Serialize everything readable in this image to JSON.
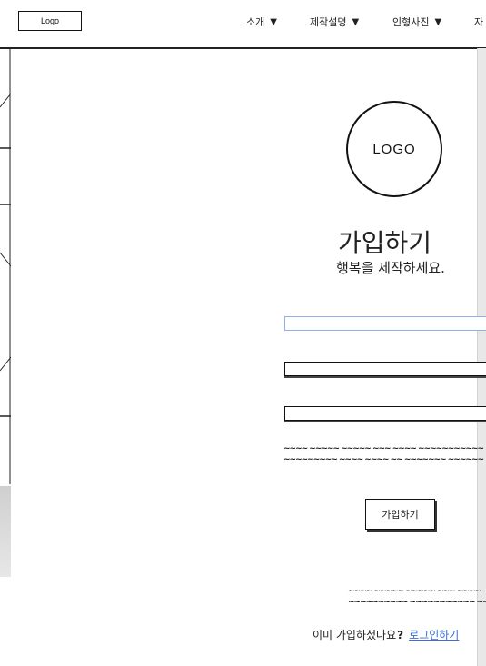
{
  "header": {
    "logo_label": "Logo",
    "nav": [
      {
        "label": "소개"
      },
      {
        "label": "제작설명"
      },
      {
        "label": "인형사진"
      },
      {
        "label": "자"
      }
    ]
  },
  "main": {
    "circle_logo_label": "LOGO",
    "title": "가입하기",
    "subtitle": "행복을 제작하세요.",
    "placeholder_scribble_1": "~~~~ ~~~~~ ~~~~~ ~~~ ~~~~ ~~~~~~~~~~~",
    "placeholder_scribble_2": "~~~~~~~~~ ~~~~ ~~~~ ~~ ~~~~~~~ ~~~~~~",
    "signup_button": "가입하기",
    "footer_scribble_1": "~~~~ ~~~~~ ~~~~~ ~~~ ~~~~",
    "footer_scribble_2": "~~~~~~~~~~ ~~~~~~~~~~~ ~~~~",
    "already_text": "이미 가입하셨나요",
    "question_mark": "?",
    "login_link": "로그인하기"
  },
  "icons": {
    "nav_caret": "caret-down-icon"
  },
  "colors": {
    "active_field_border": "#8fb0e8",
    "link": "#3b6dd8",
    "scrollbar": "#e8e8e8"
  }
}
